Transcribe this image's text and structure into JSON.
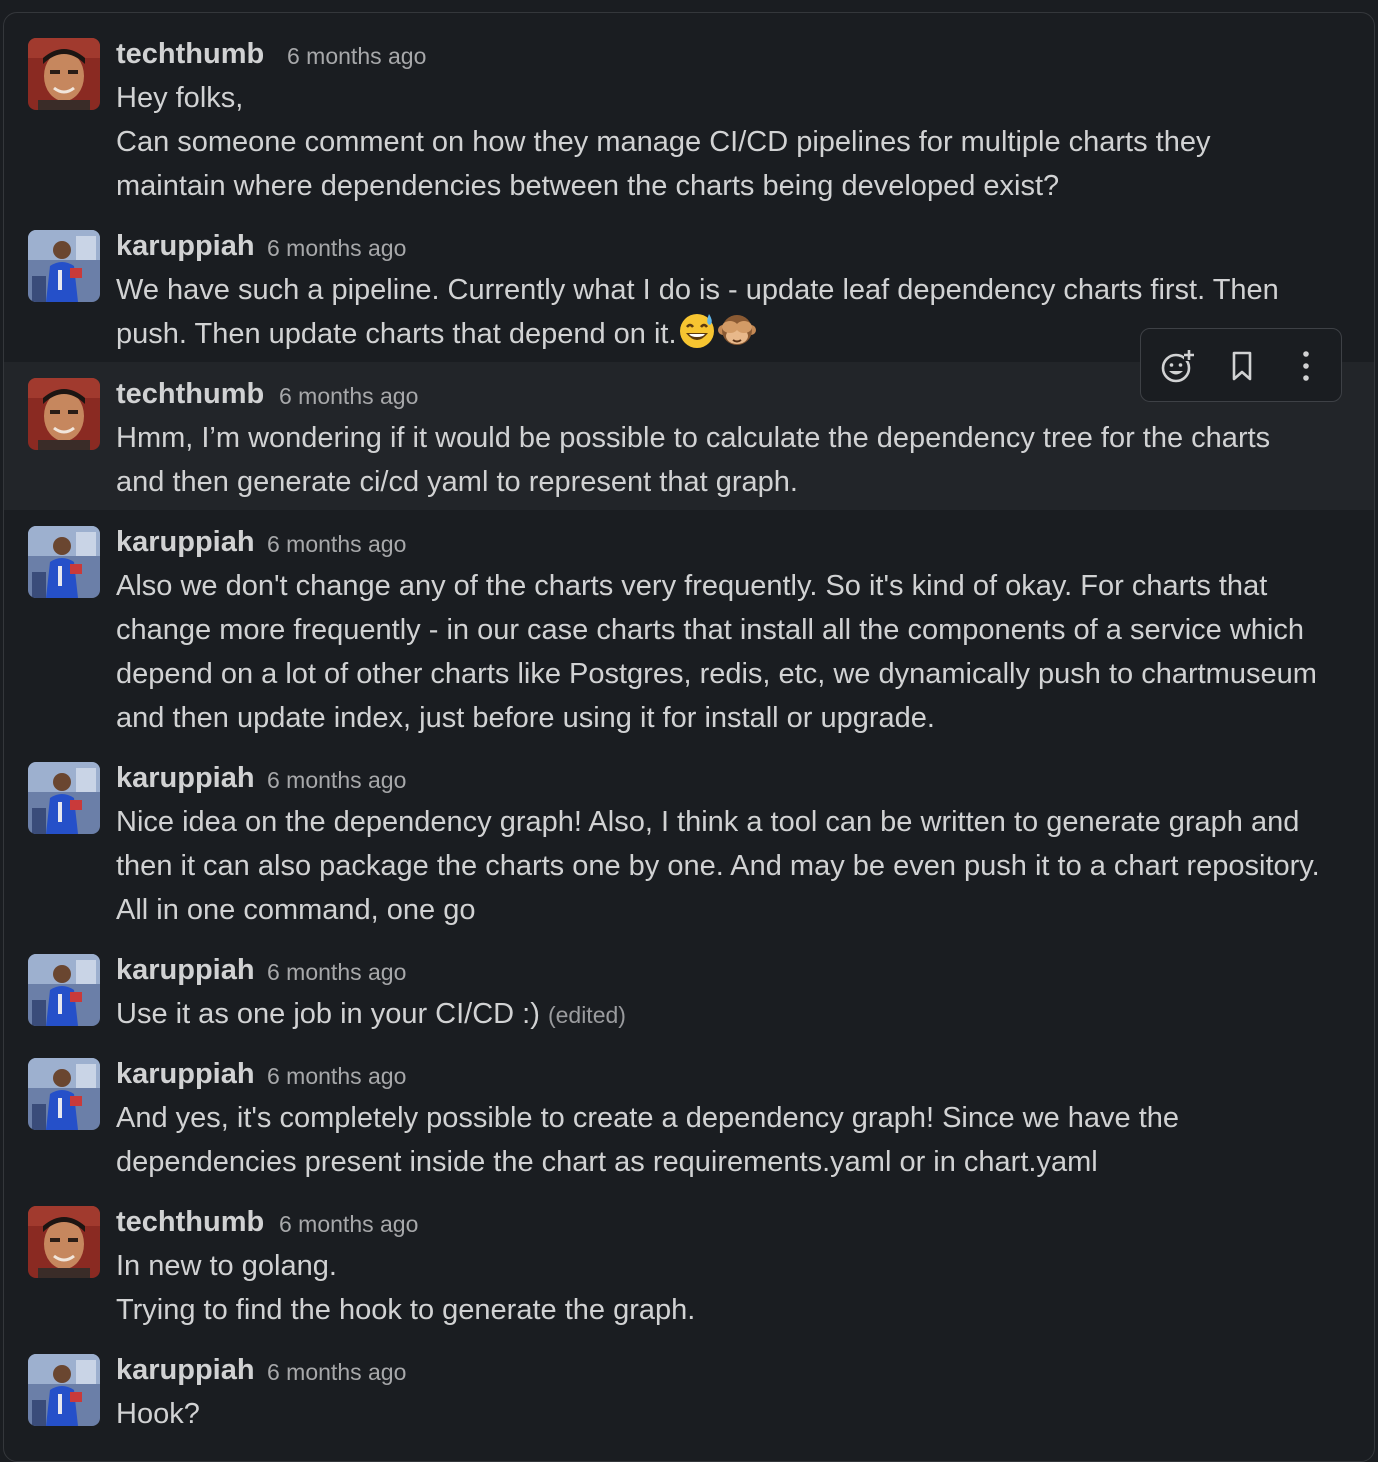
{
  "users": {
    "techthumb": {
      "name": "techthumb",
      "avatar_icon": "avatar-techthumb"
    },
    "karuppiah": {
      "name": "karuppiah",
      "avatar_icon": "avatar-karuppiah"
    }
  },
  "messages": [
    {
      "author": "techthumb",
      "time": "6 months ago",
      "lines": [
        "Hey folks,",
        "Can someone comment on how they manage CI/CD pipelines for multiple charts they",
        "maintain where dependencies between the charts being developed exist?"
      ]
    },
    {
      "author": "karuppiah",
      "time": "6 months ago",
      "lines": [
        "We have such a pipeline. Currently what I do is - update leaf dependency charts first. Then",
        "push. Then update charts that depend on it."
      ],
      "emojis": [
        "sweat-smile-emoji",
        "see-no-evil-monkey-emoji"
      ]
    },
    {
      "author": "techthumb",
      "time": "6 months ago",
      "lines": [
        "Hmm, I’m wondering if it would be possible to calculate the dependency tree for the charts",
        "and then generate ci/cd yaml to represent that graph."
      ]
    },
    {
      "author": "karuppiah",
      "time": "6 months ago",
      "lines": [
        "Also we don't change any of the charts very frequently. So it's kind of okay. For charts that",
        "change more frequently - in our case charts that install all the components of a service which",
        "depend on a lot of other charts like Postgres, redis, etc, we dynamically push to chartmuseum",
        "and then update index, just before using it for install or upgrade."
      ]
    },
    {
      "author": "karuppiah",
      "time": "6 months ago",
      "lines": [
        "Nice idea on the dependency graph! Also, I think a tool can be written to generate graph and",
        "then it can also package the charts one by one. And may be even push it to a chart repository.",
        "All in one command, one go"
      ]
    },
    {
      "author": "karuppiah",
      "time": "6 months ago",
      "lines": [
        "Use it as one job in your CI/CD :)"
      ],
      "edited": "(edited)"
    },
    {
      "author": "karuppiah",
      "time": "6 months ago",
      "lines": [
        "And yes, it's completely possible to create a dependency graph! Since we have the",
        "dependencies present inside the chart as requirements.yaml or in chart.yaml"
      ]
    },
    {
      "author": "techthumb",
      "time": "6 months ago",
      "lines": [
        "In new to golang.",
        "Trying to find the hook to generate the graph."
      ]
    },
    {
      "author": "karuppiah",
      "time": "6 months ago",
      "lines": [
        "Hook?"
      ]
    }
  ],
  "hover_actions": [
    {
      "icon": "add-reaction-icon"
    },
    {
      "icon": "bookmark-icon"
    },
    {
      "icon": "more-actions-icon"
    }
  ],
  "colors": {
    "background": "#1a1d21",
    "hover": "#222529",
    "text": "#d1d2d3",
    "muted": "#a7a8aa"
  }
}
